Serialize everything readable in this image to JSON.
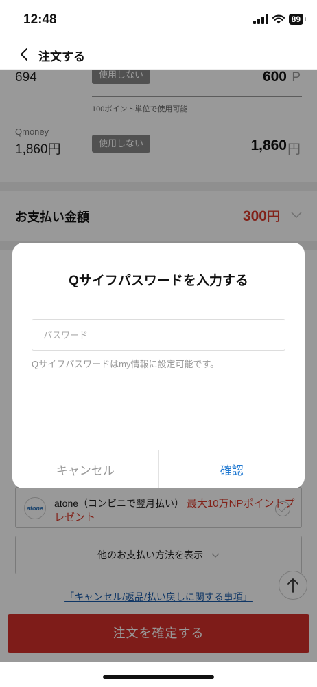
{
  "status_bar": {
    "time": "12:48",
    "battery": "89"
  },
  "nav": {
    "back_icon": "chevron-left-icon",
    "title": "注文する"
  },
  "points": {
    "row1": {
      "label": "694",
      "use_button": "使用しない",
      "amount": "600",
      "unit": "P",
      "hint": "100ポイント単位で使用可能"
    },
    "row2": {
      "sublabel": "Qmoney",
      "label": "1,860円",
      "use_button": "使用しない",
      "amount": "1,860",
      "unit": "円"
    }
  },
  "payment_total": {
    "label": "お支払い金額",
    "amount": "300",
    "unit": "円"
  },
  "methods": {
    "atone": {
      "logo": "atone",
      "name": "atone（コンビニで翌月払い）",
      "promo_line1": "最大10万NPポイントプ",
      "promo_line2": "レゼント"
    },
    "other_label": "他のお支払い方法を表示"
  },
  "terms_link": "「キャンセル/返品/払い戻しに関する事項」",
  "confirm_order_button": "注文を確定する",
  "modal": {
    "title": "Qサイフパスワードを入力する",
    "password_placeholder": "パスワード",
    "password_value": "",
    "note": "Qサイフパスワードはmy情報に設定可能です。",
    "cancel_label": "キャンセル",
    "ok_label": "確認"
  },
  "colors": {
    "accent_red": "#d2302a",
    "link_blue": "#1f78d1",
    "price_red": "#d93a2b"
  }
}
